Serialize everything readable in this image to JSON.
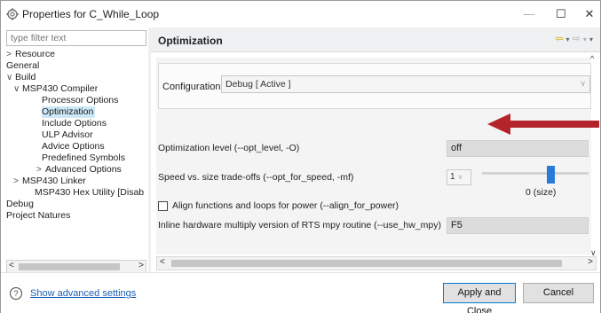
{
  "window": {
    "title": "Properties for C_While_Loop",
    "minimize": "—",
    "maximize": "☐",
    "close": "✕"
  },
  "sidebar": {
    "filter_placeholder": "type filter text",
    "items": [
      {
        "label": "Resource",
        "chevron": ">",
        "level": 0
      },
      {
        "label": "General",
        "chevron": "",
        "level": 0
      },
      {
        "label": "Build",
        "chevron": "∨",
        "level": 0
      },
      {
        "label": "MSP430 Compiler",
        "chevron": "∨",
        "level": 1
      },
      {
        "label": "Processor Options",
        "chevron": "",
        "level": 2
      },
      {
        "label": "Optimization",
        "chevron": "",
        "level": 2,
        "selected": true
      },
      {
        "label": "Include Options",
        "chevron": "",
        "level": 2
      },
      {
        "label": "ULP Advisor",
        "chevron": "",
        "level": 2
      },
      {
        "label": "Advice Options",
        "chevron": "",
        "level": 2
      },
      {
        "label": "Predefined Symbols",
        "chevron": "",
        "level": 2
      },
      {
        "label": "Advanced Options",
        "chevron": ">",
        "level": 2
      },
      {
        "label": "MSP430 Linker",
        "chevron": ">",
        "level": 1
      },
      {
        "label": "MSP430 Hex Utility  [Disab",
        "chevron": "",
        "level": 1
      },
      {
        "label": "Debug",
        "chevron": "",
        "level": 0
      },
      {
        "label": "Project Natures",
        "chevron": "",
        "level": 0
      }
    ]
  },
  "main": {
    "page_title": "Optimization",
    "configuration_label": "Configuration:",
    "configuration_value": "Debug  [ Active ]",
    "opt_level_label": "Optimization level (--opt_level, -O)",
    "opt_level_value": "off",
    "speed_label": "Speed vs. size trade-offs (--opt_for_speed, -mf)",
    "speed_value": "1",
    "speed_slider_text": "0 (size)",
    "align_label": "Align functions and loops for power (--align_for_power)",
    "align_checked": false,
    "hw_label": "Inline hardware multiply version of RTS mpy routine (--use_hw_mpy)",
    "hw_value": "F5"
  },
  "footer": {
    "help": "?",
    "advanced_link": "Show advanced settings",
    "apply_button": "Apply and Close",
    "cancel_button": "Cancel"
  },
  "colors": {
    "selection": "#cde8f7",
    "link": "#1a5fb4",
    "slider_thumb": "#2a7bd8",
    "annotation_arrow": "#b3242a"
  }
}
